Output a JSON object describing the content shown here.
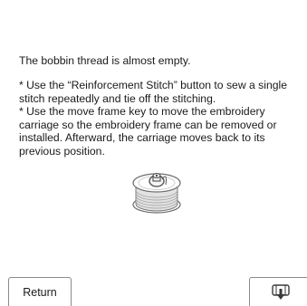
{
  "message": {
    "title": "The bobbin thread is almost empty.",
    "notes": [
      "* Use the “Reinforcement Stitch” button to sew a single",
      "stitch repeatedly and tie off the stitching.",
      "* Use the move frame key to move the embroidery",
      "carriage so the embroidery frame can be removed or",
      "installed. Afterward, the carriage moves back to its",
      "previous position."
    ]
  },
  "illustration": {
    "icon": "bobbin-icon"
  },
  "buttons": {
    "return_label": "Return",
    "move_frame_icon": "move-frame-icon"
  },
  "colors": {
    "background": "#ffffff",
    "text": "#1a1a1a",
    "button_border": "#8a8a8a"
  }
}
